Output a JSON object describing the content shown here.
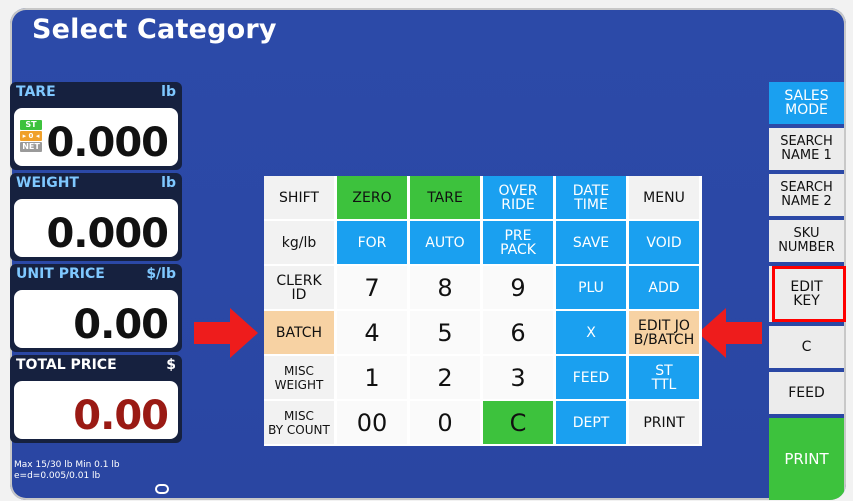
{
  "title": "Select Category",
  "panels": {
    "tare": {
      "label": "TARE",
      "unit": "lb",
      "value": "0.000",
      "tags": [
        "ST",
        "▸ 0 ◂",
        "NET"
      ]
    },
    "weight": {
      "label": "WEIGHT",
      "unit": "lb",
      "value": "0.000"
    },
    "unit_price": {
      "label": "UNIT PRICE",
      "unit": "$/lb",
      "value": "0.00"
    },
    "total_price": {
      "label": "TOTAL PRICE",
      "unit": "$",
      "value": "0.00"
    }
  },
  "footer": {
    "line1": "Max 15/30 lb Min 0.1 lb",
    "line2": "e=d=0.005/0.01 lb"
  },
  "keys": {
    "shift": "SHIFT",
    "zero": "ZERO",
    "tare": "TARE",
    "override": "OVER\nRIDE",
    "datetime": "DATE\nTIME",
    "menu": "MENU",
    "kglb": "kg/lb",
    "for": "FOR",
    "auto": "AUTO",
    "prepack": "PRE\nPACK",
    "save": "SAVE",
    "void": "VOID",
    "clerkid": "CLERK\nID",
    "d7": "7",
    "d8": "8",
    "d9": "9",
    "plu": "PLU",
    "add": "ADD",
    "batch": "BATCH",
    "d4": "4",
    "d5": "5",
    "d6": "6",
    "x": "X",
    "editjob": "EDIT JO\nB/BATCH",
    "miscweight": "MISC\nWEIGHT",
    "d1": "1",
    "d2": "2",
    "d3": "3",
    "feed": "FEED",
    "stttl": "ST\nTTL",
    "miscbycount": "MISC\nBY COUNT",
    "d00": "00",
    "d0": "0",
    "c": "C",
    "dept": "DEPT",
    "print": "PRINT"
  },
  "side": {
    "sales_mode": "SALES\nMODE",
    "search1": "SEARCH\nNAME 1",
    "search2": "SEARCH\nNAME 2",
    "sku": "SKU\nNUMBER",
    "editkey": "EDIT\nKEY",
    "c": "C",
    "feed": "FEED",
    "print": "PRINT"
  },
  "colors": {
    "screen": "#2b48a6",
    "blue_key": "#1aa0f0",
    "green_key": "#3dc23d",
    "orange_key": "#f7d2a3",
    "highlight": "#ff0000",
    "total_value": "#9a1a14"
  }
}
